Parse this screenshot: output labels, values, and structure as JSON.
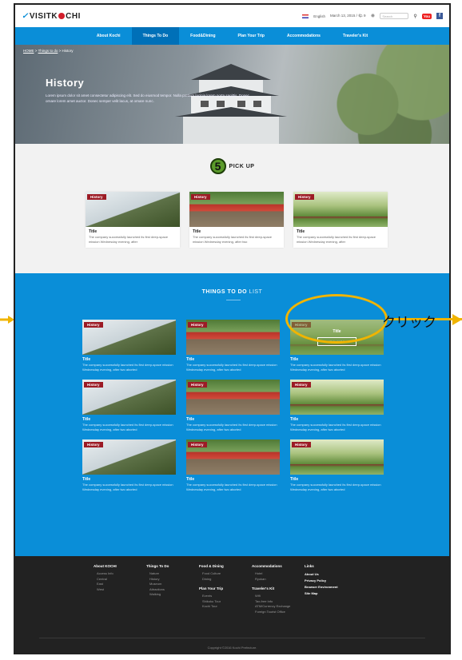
{
  "header": {
    "logo_text": "VISITKOCHI",
    "language": "English",
    "date_text": "March 13, 2015 / 🌤 9",
    "search_placeholder": "Search",
    "youtube_label": "You",
    "facebook_label": "f"
  },
  "nav": {
    "items": [
      "About Kochi",
      "Things To Do",
      "Food&Dining",
      "Plan Your Trip",
      "Accommodations",
      "Traveler's Kit"
    ],
    "active_index": 1
  },
  "hero": {
    "breadcrumb": [
      "HOME",
      "Things to do",
      "History"
    ],
    "title": "History",
    "text": "Lorem ipsum dolor sit amet consectetur adipiscing elit. Sed do eiusmod tempor. Nulla pretium lacinia lorem porta sagittis. Donec ornare lorem amet auctor. Donec semper velit lacus, at ornare nunc."
  },
  "pickup": {
    "step_number": "5",
    "title": "PICK UP",
    "cards": [
      {
        "tag": "History",
        "title": "Title",
        "desc": "The company successfully launched its first deep-space mission Wednesday evening, after",
        "image": "castle"
      },
      {
        "tag": "History",
        "title": "Title",
        "desc": "The company successfully launched its first deep-space mission Wednesday evening, after two",
        "image": "bridge"
      },
      {
        "tag": "History",
        "title": "Title",
        "desc": "The company successfully launched its first deep-space mission Wednesday evening, after",
        "image": "pagoda"
      }
    ]
  },
  "list": {
    "title_bold": "THINGS TO DO",
    "title_light": "LIST",
    "cards": [
      {
        "tag": "History",
        "title": "Title",
        "desc": "The company successfully launched its first deep-space mission Wednesday evening, after two aborted",
        "image": "castle"
      },
      {
        "tag": "History",
        "title": "Title",
        "desc": "The company successfully launched its first deep-space mission Wednesday evening, after two aborted",
        "image": "bridge"
      },
      {
        "tag": "History",
        "title": "Title",
        "desc": "The company successfully launched its first deep-space mission Wednesday evening, after two aborted",
        "image": "pagoda",
        "hover": true,
        "hover_title": "Title",
        "hover_button": "VIEW MORE"
      },
      {
        "tag": "History",
        "title": "Title",
        "desc": "The company successfully launched its first deep-space mission Wednesday evening, after two aborted",
        "image": "castle"
      },
      {
        "tag": "History",
        "title": "Title",
        "desc": "The company successfully launched its first deep-space mission Wednesday evening, after two aborted",
        "image": "bridge"
      },
      {
        "tag": "History",
        "title": "Title",
        "desc": "The company successfully launched its first deep-space mission Wednesday evening, after two aborted",
        "image": "pagoda"
      },
      {
        "tag": "History",
        "title": "Title",
        "desc": "The company successfully launched its first deep-space mission Wednesday evening, after two aborted",
        "image": "castle"
      },
      {
        "tag": "History",
        "title": "Title",
        "desc": "The company successfully launched its first deep-space mission Wednesday evening, after two aborted",
        "image": "bridge"
      },
      {
        "tag": "History",
        "title": "Title",
        "desc": "The company successfully launched its first deep-space mission Wednesday evening, after two aborted",
        "image": "pagoda"
      }
    ]
  },
  "footer": {
    "columns": [
      {
        "heading": "About KOCHI",
        "items": [
          "Access Info",
          "Central",
          "East",
          "West"
        ]
      },
      {
        "heading": "Things To Do",
        "items": [
          "Nature",
          "History",
          "Museum",
          "Attractions",
          "Walking"
        ]
      },
      {
        "heading": "Food & Dining",
        "items": [
          "Food Culture",
          "Dining"
        ],
        "sub_heading": "Plan Your Trip",
        "sub_items": [
          "Events",
          "Shikoku Tour",
          "Kochi Tour"
        ]
      },
      {
        "heading": "Accommodations",
        "items": [
          "Hotel",
          "Ryokan"
        ],
        "sub_heading": "Traveler's Kit",
        "sub_items": [
          "Wifi",
          "Tax-free Info",
          "ATM/Currency Exchange",
          "Foreign Tourist Office"
        ]
      },
      {
        "heading": "Links",
        "links": [
          "About Us",
          "Privacy Policy",
          "Browser Environment",
          "Site Map"
        ]
      }
    ],
    "copyright": "Copyright ©2016 Kochi Prefecture."
  },
  "annotation": {
    "callout_text": "クリック",
    "accent_color": "#f0b400"
  }
}
